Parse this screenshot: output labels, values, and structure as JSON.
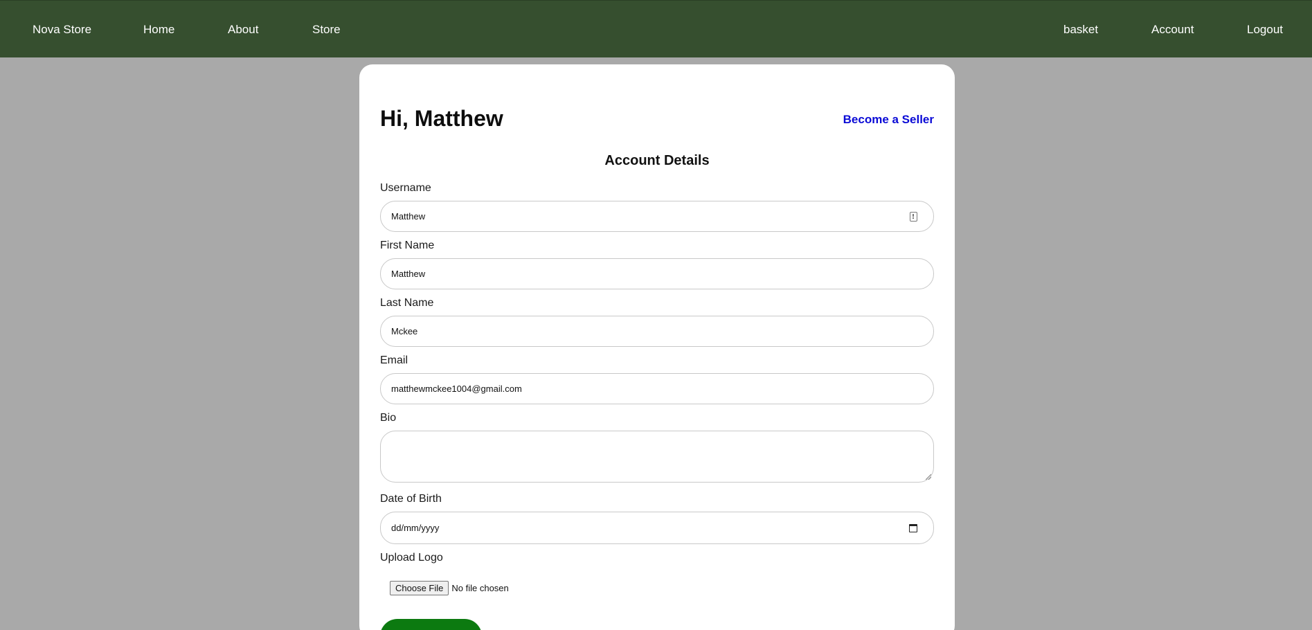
{
  "nav": {
    "brand": "Nova Store",
    "home": "Home",
    "about": "About",
    "store": "Store",
    "basket": "basket",
    "account": "Account",
    "logout": "Logout"
  },
  "header": {
    "greeting": "Hi, Matthew",
    "seller_link": "Become a Seller"
  },
  "form": {
    "title": "Account Details",
    "username": {
      "label": "Username",
      "value": "Matthew"
    },
    "first_name": {
      "label": "First Name",
      "value": "Matthew"
    },
    "last_name": {
      "label": "Last Name",
      "value": "Mckee"
    },
    "email": {
      "label": "Email",
      "value": "matthewmckee1004@gmail.com"
    },
    "bio": {
      "label": "Bio",
      "value": ""
    },
    "dob": {
      "label": "Date of Birth",
      "placeholder": "dd/mm/yyyy"
    },
    "logo": {
      "label": "Upload Logo",
      "button": "Choose File",
      "status": "No file chosen"
    }
  },
  "colors": {
    "navbar": "#364f2f",
    "background": "#a9a9a9",
    "link": "#0a0ad6",
    "save_button": "#0c7a10"
  }
}
